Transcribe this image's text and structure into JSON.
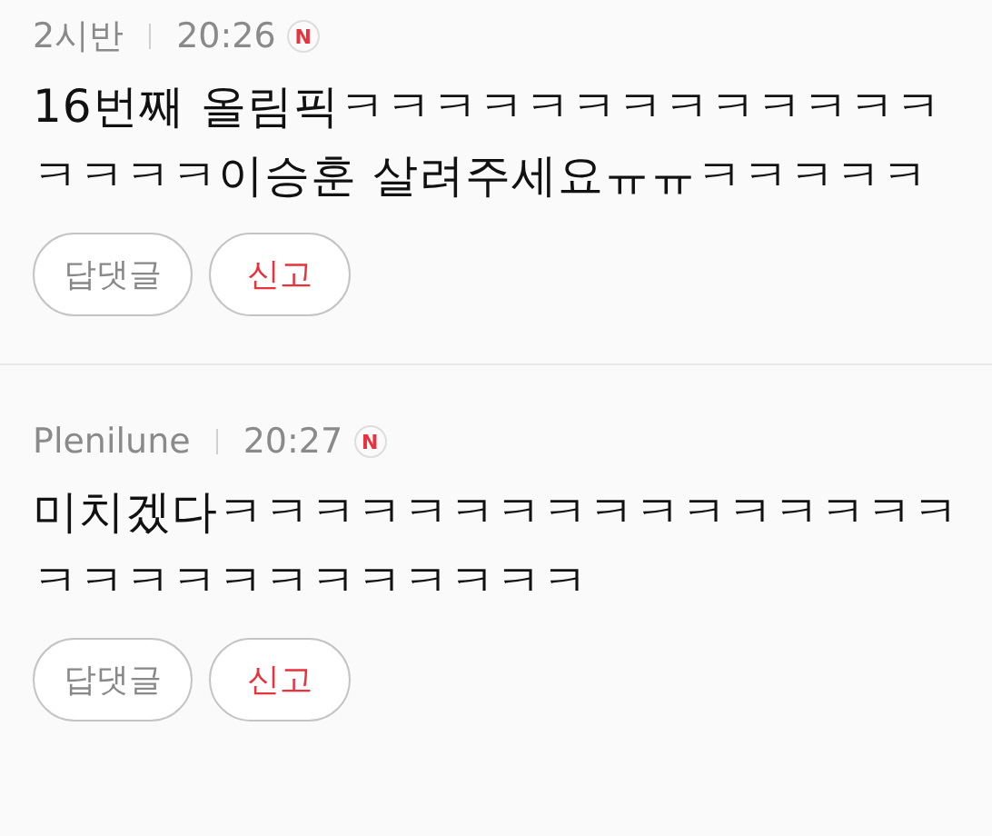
{
  "comments": [
    {
      "author": "2시반",
      "time": "20:26",
      "new_badge": "N",
      "text": "16번째 올림픽ㅋㅋㅋㅋㅋㅋㅋㅋㅋㅋㅋㅋㅋㅋㅋㅋㅋ이승훈 살려주세요ㅠㅠㅋㅋㅋㅋㅋ",
      "buttons": [
        {
          "label": "답댓글",
          "kind": "reply"
        },
        {
          "label": "신고",
          "kind": "report"
        }
      ]
    },
    {
      "author": "Plenilune",
      "time": "20:27",
      "new_badge": "N",
      "text": "미치겠다ㅋㅋㅋㅋㅋㅋㅋㅋㅋㅋㅋㅋㅋㅋㅋㅋㅋㅋㅋㅋㅋㅋㅋㅋㅋㅋㅋㅋ",
      "buttons": [
        {
          "label": "답댓글",
          "kind": "reply"
        },
        {
          "label": "신고",
          "kind": "report"
        }
      ]
    }
  ]
}
